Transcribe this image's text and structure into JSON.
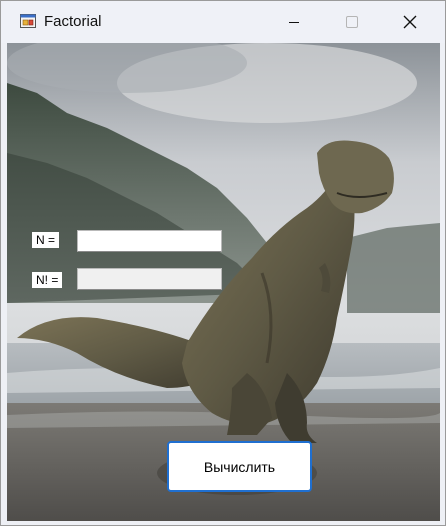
{
  "window": {
    "title": "Factorial",
    "icon": "winforms-app-icon",
    "controls": {
      "minimize_icon": "minimize-icon",
      "maximize_icon": "maximize-icon",
      "close_icon": "close-icon"
    }
  },
  "form": {
    "n_label": "N =",
    "n_value": "",
    "factorial_label": "N! =",
    "factorial_value": "",
    "calculate_label": "Вычислить"
  },
  "background": {
    "subject": "t-rex-on-beach-image"
  },
  "colors": {
    "titlebar": "#eff1f7",
    "button_border": "#1f6fd0"
  }
}
